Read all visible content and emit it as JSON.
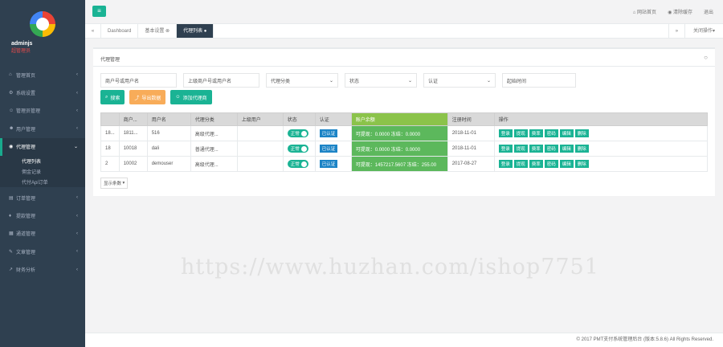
{
  "sidebar": {
    "user": "adminjs",
    "role": "超管理员",
    "items": [
      {
        "icon": "home-icon",
        "glyph": "⌂",
        "label": "管理首页"
      },
      {
        "icon": "gear-icon",
        "glyph": "⚙",
        "label": "系统设置"
      },
      {
        "icon": "user-icon",
        "glyph": "☺",
        "label": "管理员管理"
      },
      {
        "icon": "users-icon",
        "glyph": "☻",
        "label": "用户管理"
      },
      {
        "icon": "agent-icon",
        "glyph": "◉",
        "label": "代理管理"
      },
      {
        "icon": "order-icon",
        "glyph": "▤",
        "label": "订单管理"
      },
      {
        "icon": "withdraw-icon",
        "glyph": "♦",
        "label": "提款管理"
      },
      {
        "icon": "channel-icon",
        "glyph": "▦",
        "label": "通道管理"
      },
      {
        "icon": "article-icon",
        "glyph": "✎",
        "label": "文章管理"
      },
      {
        "icon": "finance-icon",
        "glyph": "↗",
        "label": "财务分析"
      }
    ],
    "submenu": [
      "代理列表",
      "佣金记录",
      "代付Api订单"
    ]
  },
  "topbar": {
    "links": [
      "网站首页",
      "清除缓存",
      "退出"
    ]
  },
  "tabs": [
    "Dashboard",
    "基本设置",
    "代理列表"
  ],
  "close_ops": "关闭操作",
  "panel": {
    "title": "代理管理"
  },
  "filters": {
    "merchant": "商户号或用户名",
    "parent": "上级商户号或用户名",
    "category": "代理分类",
    "status": "状态",
    "verify": "认证",
    "start": "起始时间"
  },
  "buttons": {
    "search": "搜索",
    "export": "导出数据",
    "add": "添加代理商"
  },
  "table": {
    "headers": [
      "",
      "商户...",
      "用户名",
      "代理分类",
      "上级用户",
      "状态",
      "认证",
      "账户余额",
      "注册时间",
      "操作"
    ],
    "rows": [
      {
        "id": "18...",
        "merchant": "1811...",
        "user": "516",
        "cat": "高级代理...",
        "parent": "",
        "status": "正常",
        "verify": "已认证",
        "balance": "可提现：0.0000 冻结：0.0000",
        "date": "2018-11-01"
      },
      {
        "id": "18",
        "merchant": "10018",
        "user": "dali",
        "cat": "普通代理...",
        "parent": "",
        "status": "正常",
        "verify": "已认证",
        "balance": "可提现：0.0000 冻结：0.0000",
        "date": "2018-11-01"
      },
      {
        "id": "2",
        "merchant": "10002",
        "user": "demouser",
        "cat": "高级代理...",
        "parent": "",
        "status": "正常",
        "verify": "已认证",
        "balance": "可提现：1457217.5607 冻结：255.00",
        "date": "2017-08-27"
      }
    ],
    "ops": [
      "登录",
      "提现",
      "费率",
      "密码",
      "编辑",
      "删除"
    ]
  },
  "pager": "显示条数",
  "watermark": "https://www.huzhan.com/ishop7751",
  "footer": "© 2017 PMT支付系统管理后台 (版本:5.8.6) All Rights Reserved."
}
